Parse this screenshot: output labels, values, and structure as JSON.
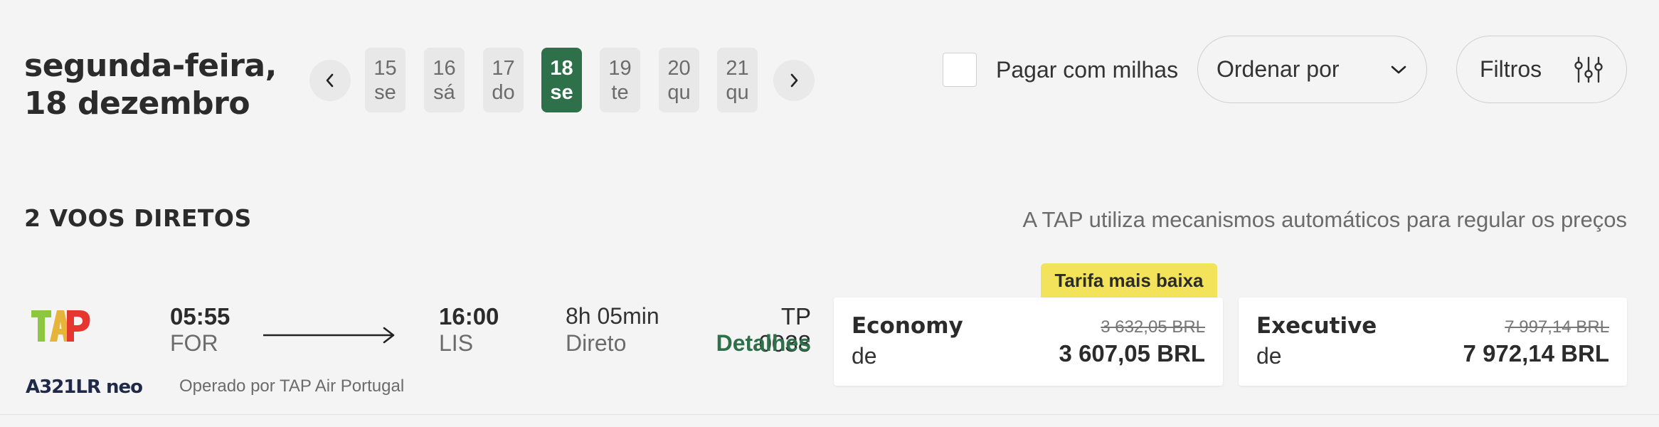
{
  "header": {
    "date_line1": "segunda-feira,",
    "date_line2": "18 dezembro"
  },
  "date_strip": {
    "days": [
      {
        "num": "15",
        "wd": "se"
      },
      {
        "num": "16",
        "wd": "sá"
      },
      {
        "num": "17",
        "wd": "do"
      },
      {
        "num": "18",
        "wd": "se"
      },
      {
        "num": "19",
        "wd": "te"
      },
      {
        "num": "20",
        "wd": "qu"
      },
      {
        "num": "21",
        "wd": "qu"
      }
    ]
  },
  "controls": {
    "miles_label": "Pagar com milhas",
    "sort_label": "Ordenar por",
    "filters_label": "Filtros"
  },
  "results": {
    "count_label": "2 VOOS DIRETOS",
    "disclaimer": "A TAP utiliza mecanismos automáticos para regular os preços"
  },
  "flight": {
    "dep_time": "05:55",
    "dep_code": "FOR",
    "arr_time": "16:00",
    "arr_code": "LIS",
    "duration": "8h 05min",
    "stops": "Direto",
    "number": "TP 0038",
    "details_label": "Detalhes",
    "operated_by": "Operado por TAP Air Portugal",
    "aircraft_logo_text": "A321LR neo",
    "badge": "Tarifa mais baixa",
    "fares": [
      {
        "name": "Economy",
        "prefix": "de",
        "old_price": "3 632,05 BRL",
        "price": "3 607,05 BRL"
      },
      {
        "name": "Executive",
        "prefix": "de",
        "old_price": "7 997,14 BRL",
        "price": "7 972,14 BRL"
      }
    ]
  },
  "colors": {
    "accent_green": "#2e7049",
    "badge_yellow": "#f3e35a",
    "tap_red": "#e63630",
    "tap_green": "#8dc63f"
  }
}
